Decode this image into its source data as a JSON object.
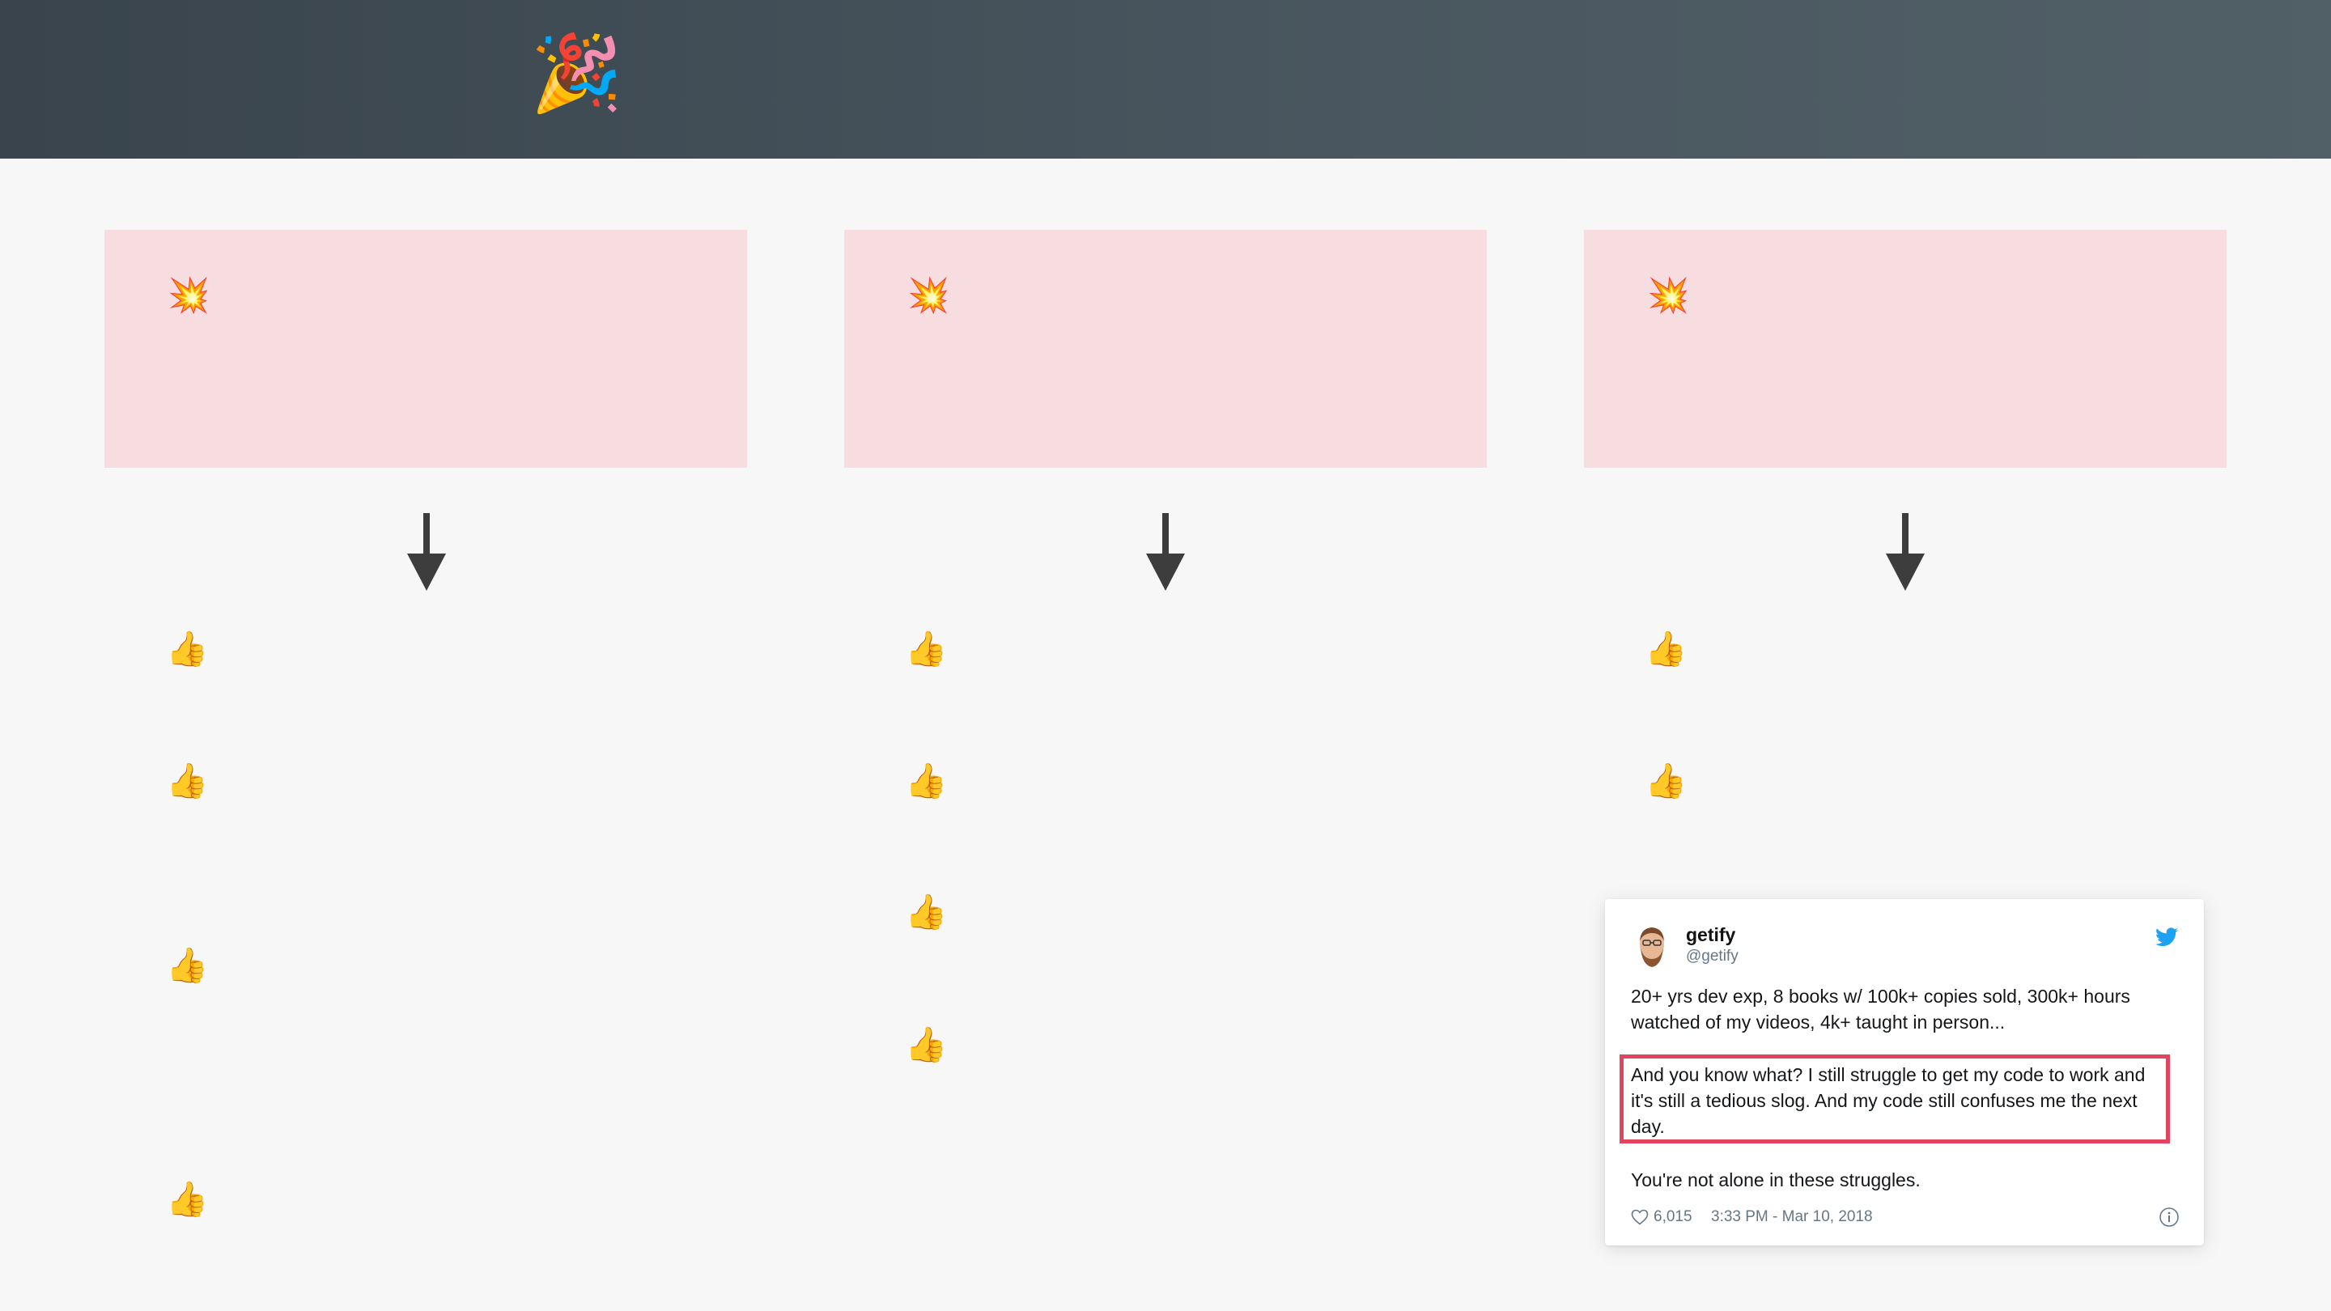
{
  "header": {
    "emoji": "🎉"
  },
  "columns": [
    {
      "card": {
        "emoji": "💥"
      },
      "items": [
        "👍",
        "👍",
        "👍",
        "👍"
      ]
    },
    {
      "card": {
        "emoji": "💥"
      },
      "items": [
        "👍",
        "👍",
        "👍",
        "👍"
      ]
    },
    {
      "card": {
        "emoji": "💥"
      },
      "items": [
        "👍",
        "👍"
      ]
    }
  ],
  "tweet": {
    "name": "getify",
    "handle": "@getify",
    "paragraph1": "20+ yrs dev exp, 8 books w/ 100k+ copies sold, 300k+ hours watched of my videos, 4k+ taught in person...",
    "paragraph2": "And you know what? I still struggle to get my code to work and it's still a tedious slog. And my code still confuses me the next day.",
    "paragraph3": "You're not alone in these struggles.",
    "likes": "6,015",
    "timestamp": "3:33 PM - Mar 10, 2018",
    "icons": [
      "twitter-bird-icon",
      "heart-icon",
      "info-icon"
    ]
  },
  "colors": {
    "header": "#3c474f",
    "card": "#f7dde0",
    "arrow": "#3d3d3d",
    "highlight": "#e0445e",
    "twitter_blue": "#1da1f2"
  }
}
